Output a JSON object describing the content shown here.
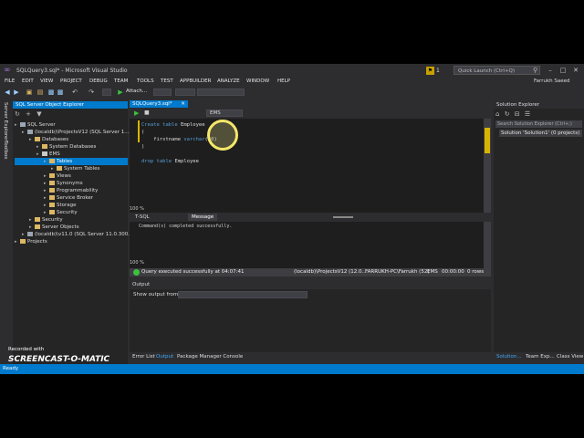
{
  "window": {
    "title": "SQLQuery3.sql* - Microsoft Visual Studio",
    "notification_count": "1",
    "quick_launch_placeholder": "Quick Launch (Ctrl+Q)",
    "user": "Farrukh Saeed"
  },
  "menu": [
    "FILE",
    "EDIT",
    "VIEW",
    "PROJECT",
    "DEBUG",
    "TEAM",
    "TOOLS",
    "TEST",
    "APPBUILDER",
    "ANALYZE",
    "WINDOW",
    "HELP"
  ],
  "toolbar": {
    "attach_label": "Attach..."
  },
  "left_tabs": [
    "Server Explorer",
    "Toolbox"
  ],
  "sql_explorer": {
    "title": "SQL Server Object Explorer",
    "tree": [
      {
        "label": "SQL Server",
        "indent": 0,
        "icon": "server"
      },
      {
        "label": "(localdb)\\ProjectsV12 (SQL Server 1...",
        "indent": 1,
        "icon": "server"
      },
      {
        "label": "Databases",
        "indent": 2,
        "icon": "folder"
      },
      {
        "label": "System Databases",
        "indent": 3,
        "icon": "folder"
      },
      {
        "label": "EMS",
        "indent": 3,
        "icon": "db"
      },
      {
        "label": "Tables",
        "indent": 4,
        "icon": "folder",
        "selected": true
      },
      {
        "label": "System Tables",
        "indent": 5,
        "icon": "folder"
      },
      {
        "label": "Views",
        "indent": 4,
        "icon": "folder"
      },
      {
        "label": "Synonyms",
        "indent": 4,
        "icon": "folder"
      },
      {
        "label": "Programmability",
        "indent": 4,
        "icon": "folder"
      },
      {
        "label": "Service Broker",
        "indent": 4,
        "icon": "folder"
      },
      {
        "label": "Storage",
        "indent": 4,
        "icon": "folder"
      },
      {
        "label": "Security",
        "indent": 4,
        "icon": "folder"
      },
      {
        "label": "Security",
        "indent": 2,
        "icon": "folder"
      },
      {
        "label": "Server Objects",
        "indent": 2,
        "icon": "folder"
      },
      {
        "label": "(localdb)\\v11.0 (SQL Server 11.0.300...",
        "indent": 1,
        "icon": "server"
      },
      {
        "label": "Projects",
        "indent": 0,
        "icon": "folder"
      }
    ]
  },
  "editor": {
    "tab_label": "SQLQuery3.sql*",
    "db_label": "EMS",
    "zoom": "100 %",
    "code_lines": [
      [
        {
          "t": "kw",
          "v": "Create table "
        },
        {
          "t": "tx",
          "v": "Employee"
        }
      ],
      [
        {
          "t": "tx",
          "v": "("
        }
      ],
      [
        {
          "t": "tx",
          "v": "    firstname "
        },
        {
          "t": "kw",
          "v": "varchar"
        },
        {
          "t": "tx",
          "v": "("
        },
        {
          "t": "num",
          "v": "50"
        },
        {
          "t": "tx",
          "v": ")"
        }
      ],
      [
        {
          "t": "tx",
          "v": ")"
        }
      ],
      [
        {
          "t": "tx",
          "v": ""
        }
      ],
      [
        {
          "t": "kw",
          "v": "drop table "
        },
        {
          "t": "tx",
          "v": "Employee"
        }
      ]
    ]
  },
  "results": {
    "tab_tsql": "T-SQL",
    "tab_message": "Message",
    "zoom": "100 %",
    "message": "Command(s) completed successfully.",
    "status_text": "Query executed successfully at 04:07:41",
    "status_server": "(localdb)\\ProjectsV12 (12.0...",
    "status_user": "FARRUKH-PC\\Farrukh (52)",
    "status_db": "EMS",
    "status_time": "00:00:00",
    "status_rows": "0 rows"
  },
  "output": {
    "title": "Output",
    "show_from_label": "Show output from:"
  },
  "bottom_tabs": [
    "Error List",
    "Output",
    "Package Manager Console"
  ],
  "solution_explorer": {
    "title": "Solution Explorer",
    "search_placeholder": "Search Solution Explorer (Ctrl+;)",
    "item": "Solution 'Solution1' (0 projects)",
    "bottom_tabs": [
      "Solution...",
      "Team Exp...",
      "Class View"
    ]
  },
  "watermark": {
    "recorded_with": "Recorded with",
    "brand": "SCREENCAST-O-MATIC"
  },
  "statusbar": {
    "text": "Ready"
  },
  "colors": {
    "accent": "#007acc",
    "ide_bg": "#2d2d30",
    "editor_bg": "#1e1e1e",
    "keyword": "#569cd6",
    "highlight_circle": "#f0e68c"
  }
}
